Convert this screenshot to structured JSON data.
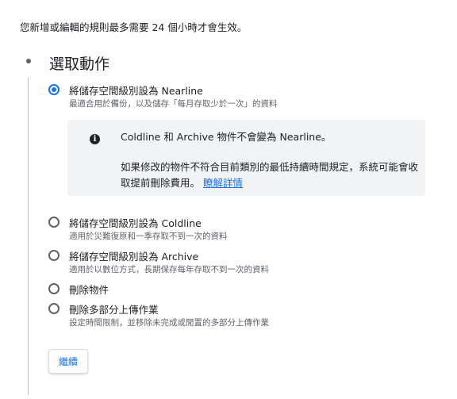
{
  "intro_text": "您新增或編輯的規則最多需要 24 個小時才會生效。",
  "step": {
    "title": "選取動作"
  },
  "options": [
    {
      "label": "將儲存空間級別設為 Nearline",
      "description": "最適合用於備份，以及儲存「每月存取少於一次」的資料",
      "selected": true
    },
    {
      "label": "將儲存空間級別設為 Coldline",
      "description": "適用於災難復原和一季存取不到一次的資料",
      "selected": false
    },
    {
      "label": "將儲存空間級別設為 Archive",
      "description": "適用於以數位方式，長期保存每年存取不到一次的資料",
      "selected": false
    },
    {
      "label": "刪除物件",
      "description": "",
      "selected": false
    },
    {
      "label": "刪除多部分上傳作業",
      "description": "設定時間限制，並移除未完成或閒置的多部分上傳作業",
      "selected": false
    }
  ],
  "info": {
    "icon": "info-icon",
    "title": "Coldline 和 Archive 物件不會變為 Nearline。",
    "body": "如果修改的物件不符合目前類別的最低持續時間規定，系統可能會收取提前刪除費用。",
    "link": "瞭解詳情"
  },
  "continue_button": "繼續",
  "colors": {
    "accent": "#1a73e8",
    "info_bg": "#f1f3f4"
  }
}
